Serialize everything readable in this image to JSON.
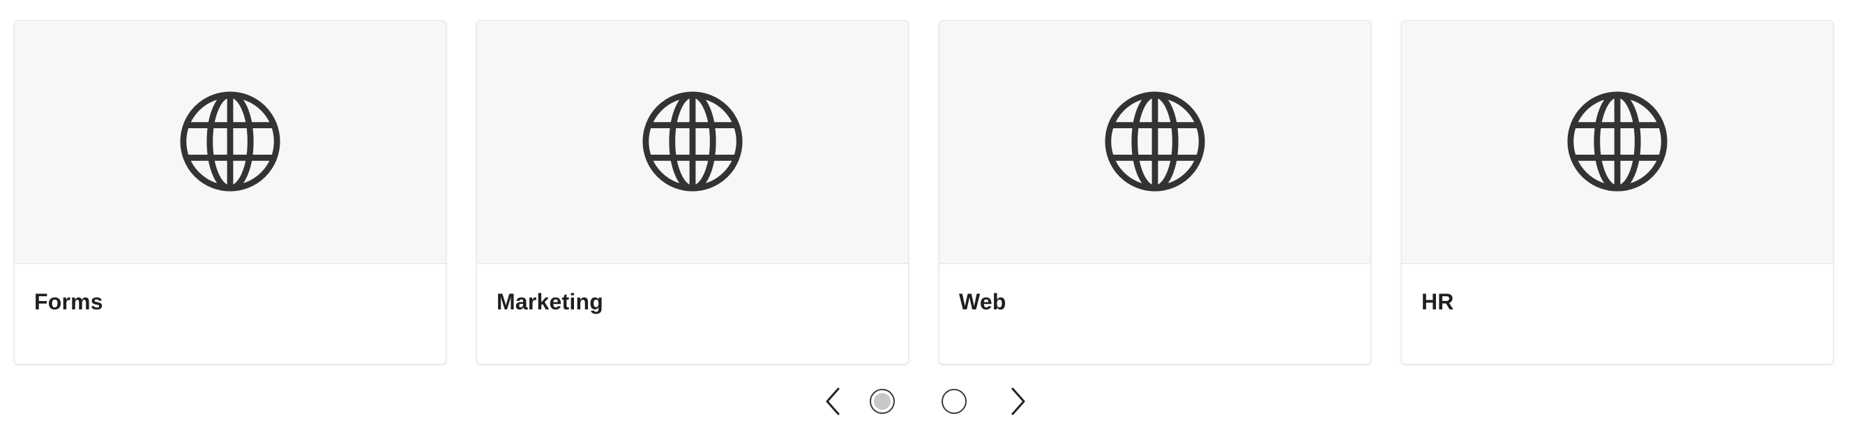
{
  "carousel": {
    "cards": [
      {
        "title": "Forms",
        "icon": "globe-icon"
      },
      {
        "title": "Marketing",
        "icon": "globe-icon"
      },
      {
        "title": "Web",
        "icon": "globe-icon"
      },
      {
        "title": "HR",
        "icon": "globe-icon"
      }
    ],
    "pagination": {
      "prev_icon": "chevron-left-icon",
      "next_icon": "chevron-right-icon",
      "pages": 2,
      "active_page": 1
    }
  },
  "colors": {
    "icon": "#333333",
    "card_media_bg": "#f8f7f6",
    "title_text": "#1f1f1f",
    "active_dot_fill": "#c8c8c8"
  }
}
